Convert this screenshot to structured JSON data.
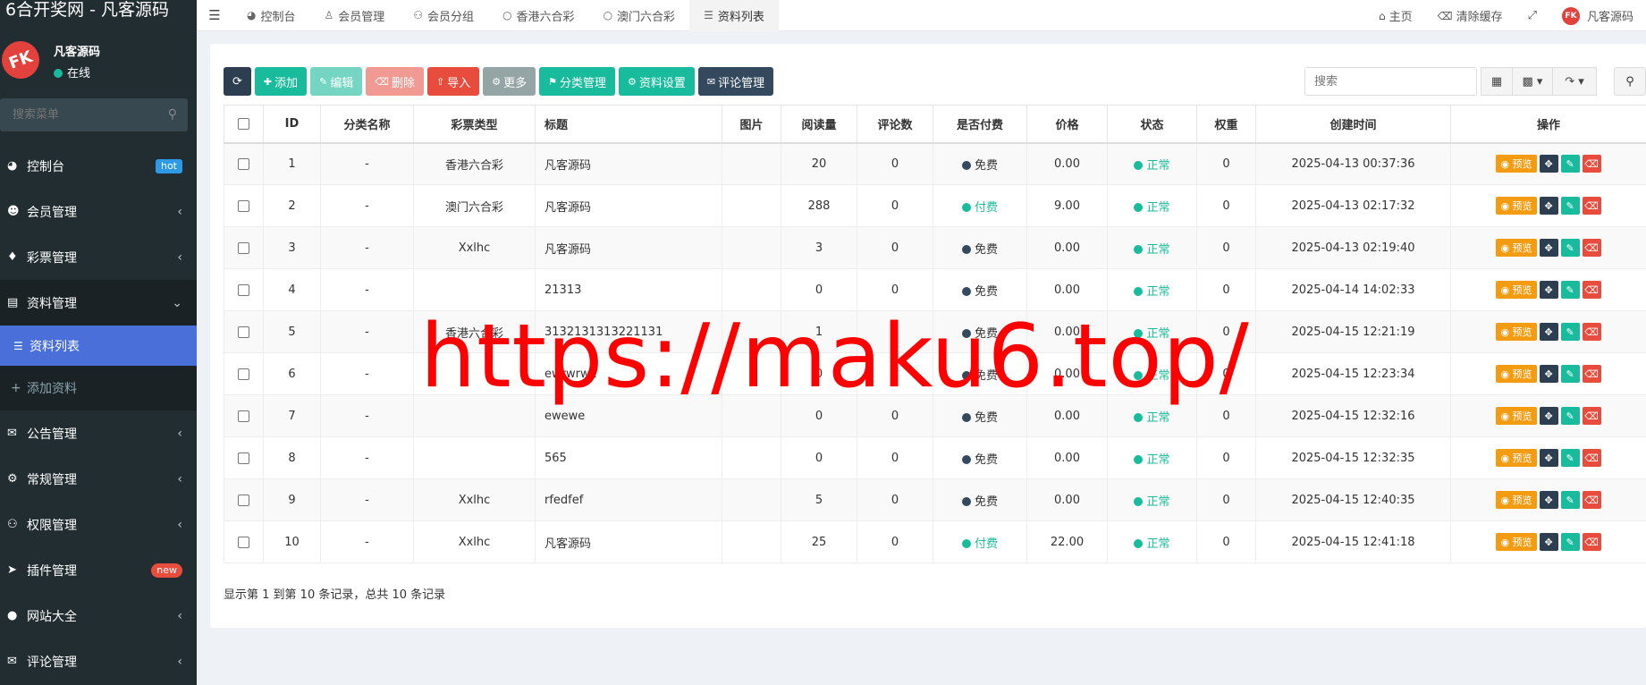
{
  "app": {
    "title": "6合开奖网 - 凡客源码"
  },
  "user": {
    "avatar_text": "FK",
    "name": "凡客源码",
    "status": "在线"
  },
  "sidebar": {
    "search_placeholder": "搜索菜单",
    "items": [
      {
        "label": "控制台",
        "icon": "dashboard-icon",
        "badge": "hot"
      },
      {
        "label": "会员管理",
        "icon": "user-circle-icon"
      },
      {
        "label": "彩票管理",
        "icon": "ticket-icon"
      },
      {
        "label": "资料管理",
        "icon": "file-icon"
      },
      {
        "label": "公告管理",
        "icon": "bullhorn-icon"
      },
      {
        "label": "常规管理",
        "icon": "cogs-icon"
      },
      {
        "label": "权限管理",
        "icon": "group-icon"
      },
      {
        "label": "插件管理",
        "icon": "rocket-icon",
        "badge": "new"
      },
      {
        "label": "网站大全",
        "icon": "globe-icon"
      },
      {
        "label": "评论管理",
        "icon": "comments-icon"
      }
    ],
    "sub_items": [
      {
        "label": "资料列表",
        "active": true
      },
      {
        "label": "添加资料",
        "active": false
      }
    ]
  },
  "topnav": {
    "tabs": [
      {
        "label": "控制台",
        "icon": "dashboard-icon"
      },
      {
        "label": "会员管理",
        "icon": "user-icon"
      },
      {
        "label": "会员分组",
        "icon": "users-icon"
      },
      {
        "label": "香港六合彩",
        "icon": "circle-icon"
      },
      {
        "label": "澳门六合彩",
        "icon": "circle-icon"
      },
      {
        "label": "资料列表",
        "icon": "list-icon",
        "active": true
      }
    ],
    "right": {
      "home": "主页",
      "clear_cache": "清除缓存",
      "user": "凡客源码"
    }
  },
  "toolbar": {
    "add": "添加",
    "edit": "编辑",
    "delete": "删除",
    "import": "导入",
    "more": "更多",
    "category": "分类管理",
    "settings": "资料设置",
    "comments": "评论管理",
    "search_placeholder": "搜索"
  },
  "table": {
    "columns": [
      "ID",
      "分类名称",
      "彩票类型",
      "标题",
      "图片",
      "阅读量",
      "评论数",
      "是否付费",
      "价格",
      "状态",
      "权重",
      "创建时间",
      "操作"
    ],
    "rows": [
      {
        "id": "1",
        "category": "-",
        "lottery": "香港六合彩",
        "title": "凡客源码",
        "views": "20",
        "comments": "0",
        "fee": "免费",
        "price": "0.00",
        "status": "正常",
        "weight": "0",
        "created": "2025-04-13 00:37:36"
      },
      {
        "id": "2",
        "category": "-",
        "lottery": "澳门六合彩",
        "title": "凡客源码",
        "views": "288",
        "comments": "0",
        "fee": "付费",
        "price": "9.00",
        "status": "正常",
        "weight": "0",
        "created": "2025-04-13 02:17:32"
      },
      {
        "id": "3",
        "category": "-",
        "lottery": "Xxlhc",
        "title": "凡客源码",
        "views": "3",
        "comments": "0",
        "fee": "免费",
        "price": "0.00",
        "status": "正常",
        "weight": "0",
        "created": "2025-04-13 02:19:40"
      },
      {
        "id": "4",
        "category": "-",
        "lottery": "",
        "title": "21313",
        "views": "0",
        "comments": "0",
        "fee": "免费",
        "price": "0.00",
        "status": "正常",
        "weight": "0",
        "created": "2025-04-14 14:02:33"
      },
      {
        "id": "5",
        "category": "-",
        "lottery": "香港六合彩",
        "title": "3132131313221131",
        "views": "1",
        "comments": "0",
        "fee": "免费",
        "price": "0.00",
        "status": "正常",
        "weight": "0",
        "created": "2025-04-15 12:21:19"
      },
      {
        "id": "6",
        "category": "-",
        "lottery": "",
        "title": "ewrwrw2",
        "views": "0",
        "comments": "0",
        "fee": "免费",
        "price": "0.00",
        "status": "正常",
        "weight": "0",
        "created": "2025-04-15 12:23:34"
      },
      {
        "id": "7",
        "category": "-",
        "lottery": "",
        "title": "ewewe",
        "views": "0",
        "comments": "0",
        "fee": "免费",
        "price": "0.00",
        "status": "正常",
        "weight": "0",
        "created": "2025-04-15 12:32:16"
      },
      {
        "id": "8",
        "category": "-",
        "lottery": "",
        "title": "565",
        "views": "0",
        "comments": "0",
        "fee": "免费",
        "price": "0.00",
        "status": "正常",
        "weight": "0",
        "created": "2025-04-15 12:32:35"
      },
      {
        "id": "9",
        "category": "-",
        "lottery": "Xxlhc",
        "title": "rfedfef",
        "views": "5",
        "comments": "0",
        "fee": "免费",
        "price": "0.00",
        "status": "正常",
        "weight": "0",
        "created": "2025-04-15 12:40:35"
      },
      {
        "id": "10",
        "category": "-",
        "lottery": "Xxlhc",
        "title": "凡客源码",
        "views": "25",
        "comments": "0",
        "fee": "付费",
        "price": "22.00",
        "status": "正常",
        "weight": "0",
        "created": "2025-04-15 12:41:18"
      }
    ],
    "action_preview": "预览"
  },
  "pagination": {
    "info": "显示第 1 到第 10 条记录，总共 10 条记录"
  },
  "watermark": "https://maku6.top/",
  "colors": {
    "sidebar_bg": "#222d32",
    "active_menu": "#4a6fd8",
    "teal": "#18bc9c",
    "red": "#e74c3c",
    "orange": "#f39c12",
    "navy": "#2c3e50"
  }
}
